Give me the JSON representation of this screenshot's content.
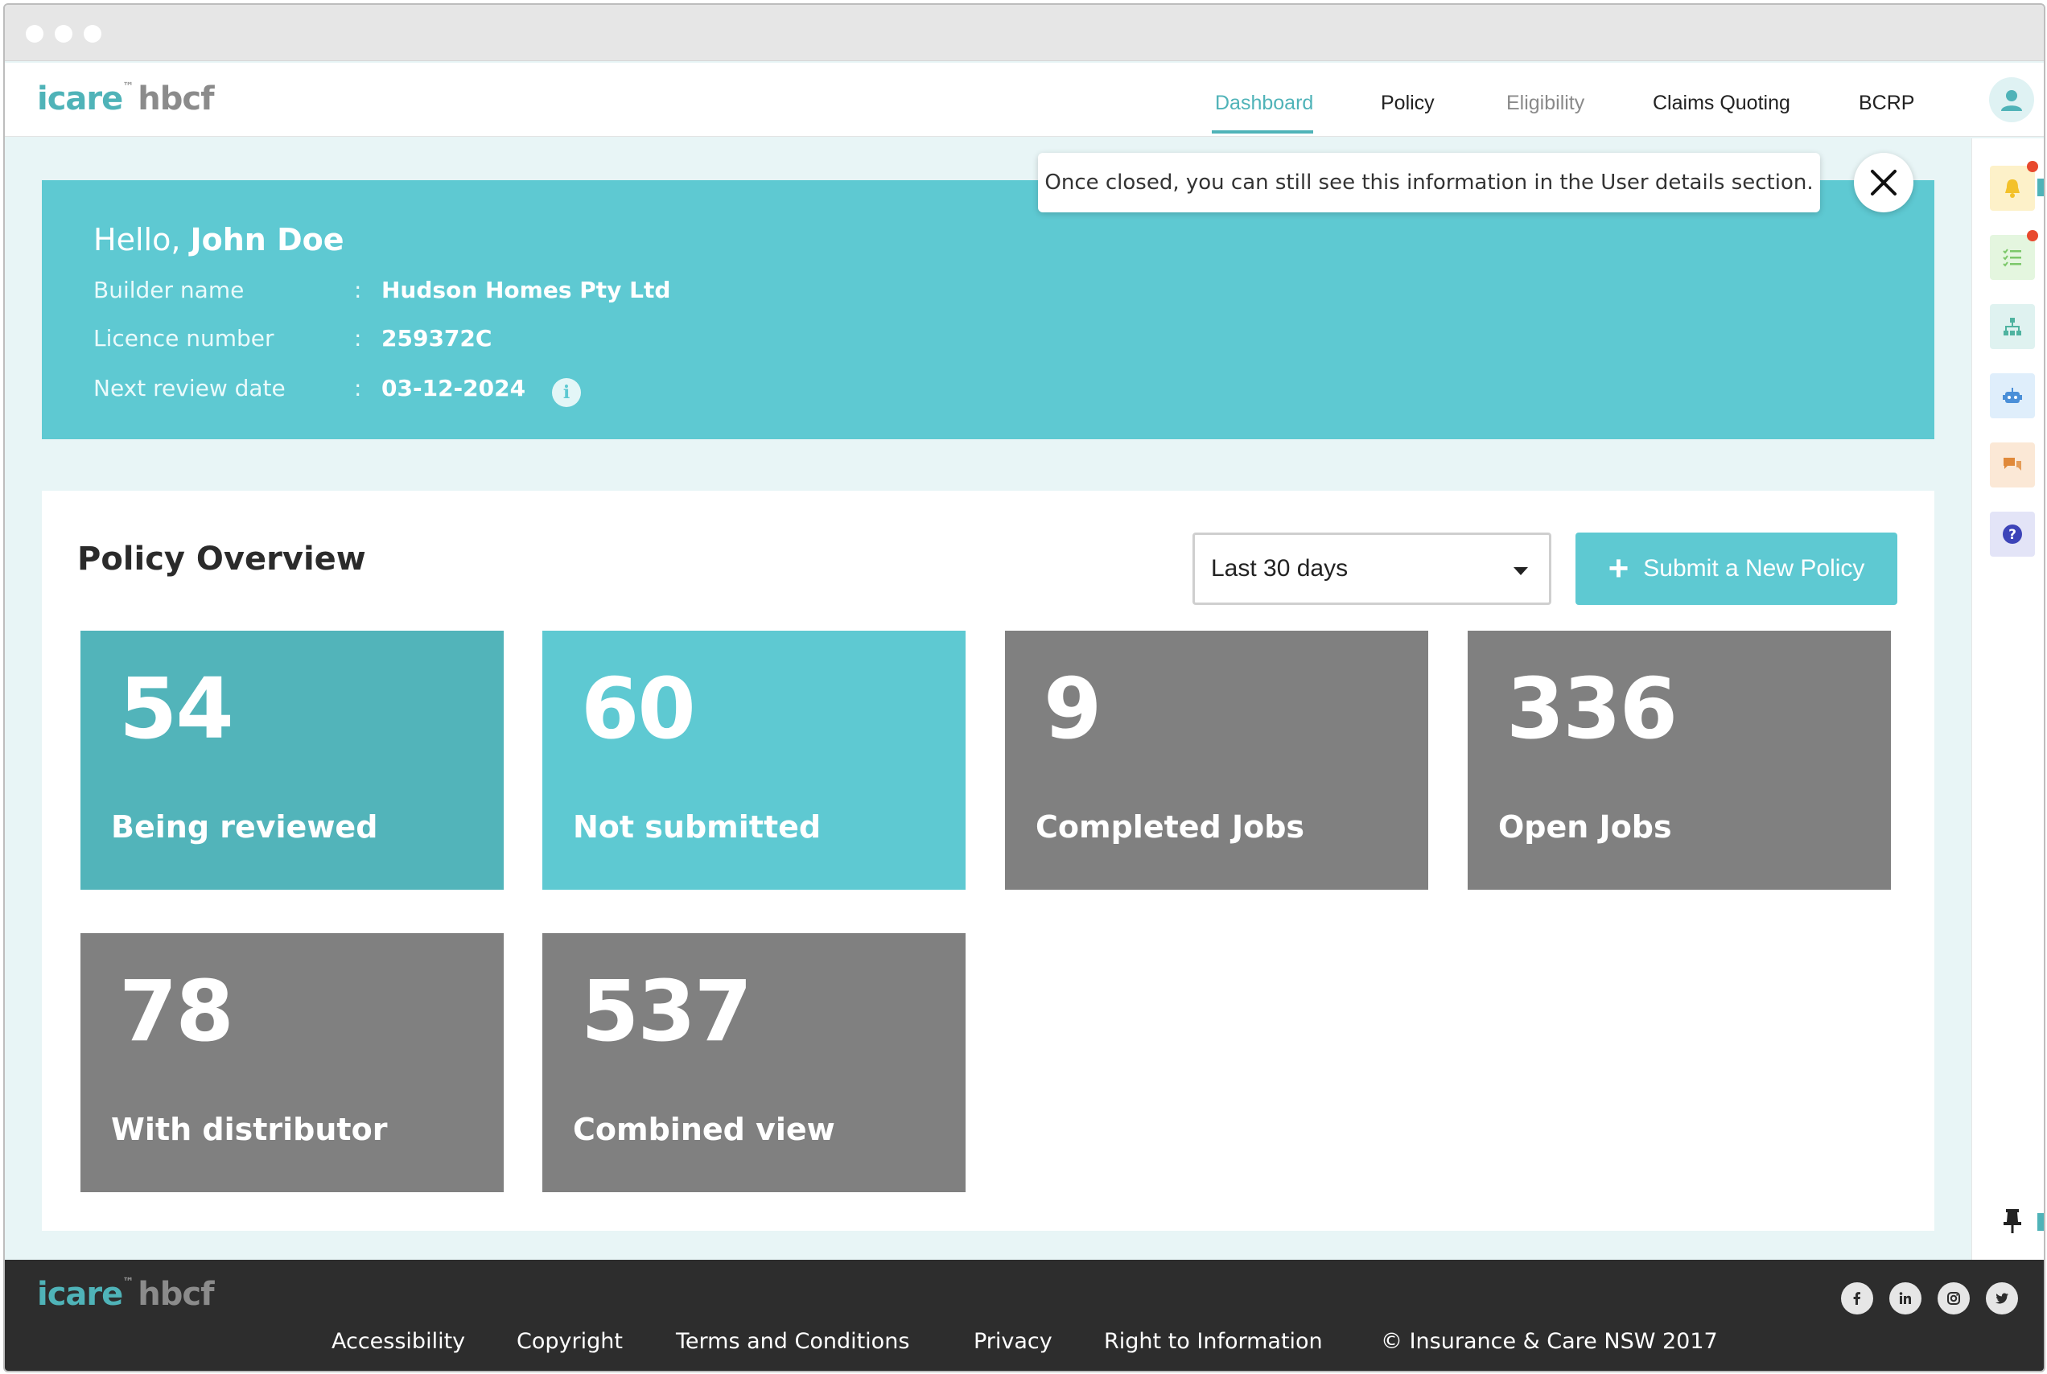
{
  "brand": {
    "logo_primary": "icare",
    "logo_tm": "™",
    "logo_secondary": "hbcf"
  },
  "nav": {
    "dashboard": "Dashboard",
    "policy": "Policy",
    "eligibility": "Eligibility",
    "claims": "Claims Quoting",
    "bcrp": "BCRP"
  },
  "tooltip": {
    "text": "Once closed, you can still see this information in the User details section.",
    "close_icon": "close-icon"
  },
  "hero": {
    "greeting": "Hello,",
    "user_name": "John Doe",
    "rows": [
      {
        "label": "Builder name",
        "value": "Hudson Homes Pty Ltd"
      },
      {
        "label": "Licence number",
        "value": "259372C"
      },
      {
        "label": "Next review date",
        "value": "03-12-2024"
      }
    ],
    "separator": ":"
  },
  "overview": {
    "title": "Policy Overview",
    "filter_value": "Last 30 days",
    "submit_label": "Submit a New Policy",
    "cards": [
      {
        "value": "54",
        "label": "Being reviewed",
        "color": "#52b4ba"
      },
      {
        "value": "60",
        "label": "Not submitted",
        "color": "#5ec9d2"
      },
      {
        "value": "9",
        "label": "Completed Jobs",
        "color": "#808080"
      },
      {
        "value": "336",
        "label": "Open Jobs",
        "color": "#808080"
      },
      {
        "value": "78",
        "label": "With distributor",
        "color": "#808080"
      },
      {
        "value": "537",
        "label": "Combined view",
        "color": "#808080"
      }
    ]
  },
  "sidebar": {
    "icons": [
      "bell-icon",
      "checklist-icon",
      "sitemap-icon",
      "robot-icon",
      "chat-icon",
      "help-icon",
      "pin-icon"
    ]
  },
  "footer": {
    "links": [
      "Accessibility",
      "Copyright",
      "Terms and Conditions",
      "Privacy",
      "Right to Information"
    ],
    "copyright": "© Insurance & Care NSW 2017",
    "social": [
      "facebook-icon",
      "linkedin-icon",
      "instagram-icon",
      "twitter-icon"
    ]
  },
  "colors": {
    "accent": "#5ec9d2",
    "accent_dark": "#52b4ba",
    "grey_card": "#808080",
    "footer_bg": "#2d2d2d"
  }
}
